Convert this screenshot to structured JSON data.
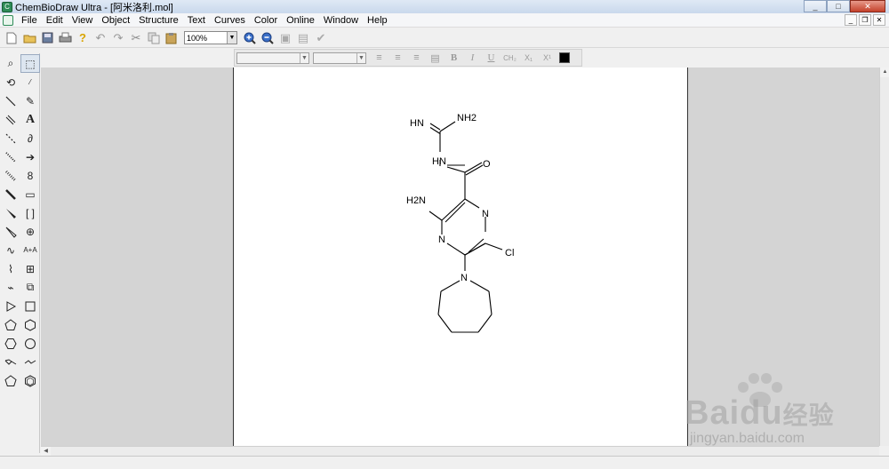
{
  "window": {
    "title": "ChemBioDraw Ultra - [阿米洛利.mol]"
  },
  "menu": [
    "File",
    "Edit",
    "View",
    "Object",
    "Structure",
    "Text",
    "Curves",
    "Color",
    "Online",
    "Window",
    "Help"
  ],
  "toolbar": {
    "zoom": "100%"
  },
  "text_toolbar": {
    "labels": [
      "B",
      "I",
      "U",
      "CH₂",
      "X₁",
      "X¹"
    ]
  },
  "molecule": {
    "labels": {
      "imine": "HN",
      "amine_top": "NH2",
      "amide_nh": "HN",
      "carbonyl_o": "O",
      "amino": "H2N",
      "ring_n1": "N",
      "ring_n2": "N",
      "chloro": "Cl",
      "azepane_n": "N"
    }
  },
  "watermark": {
    "brand": "Baidu",
    "suffix": "经验",
    "url": "jingyan.baidu.com"
  }
}
